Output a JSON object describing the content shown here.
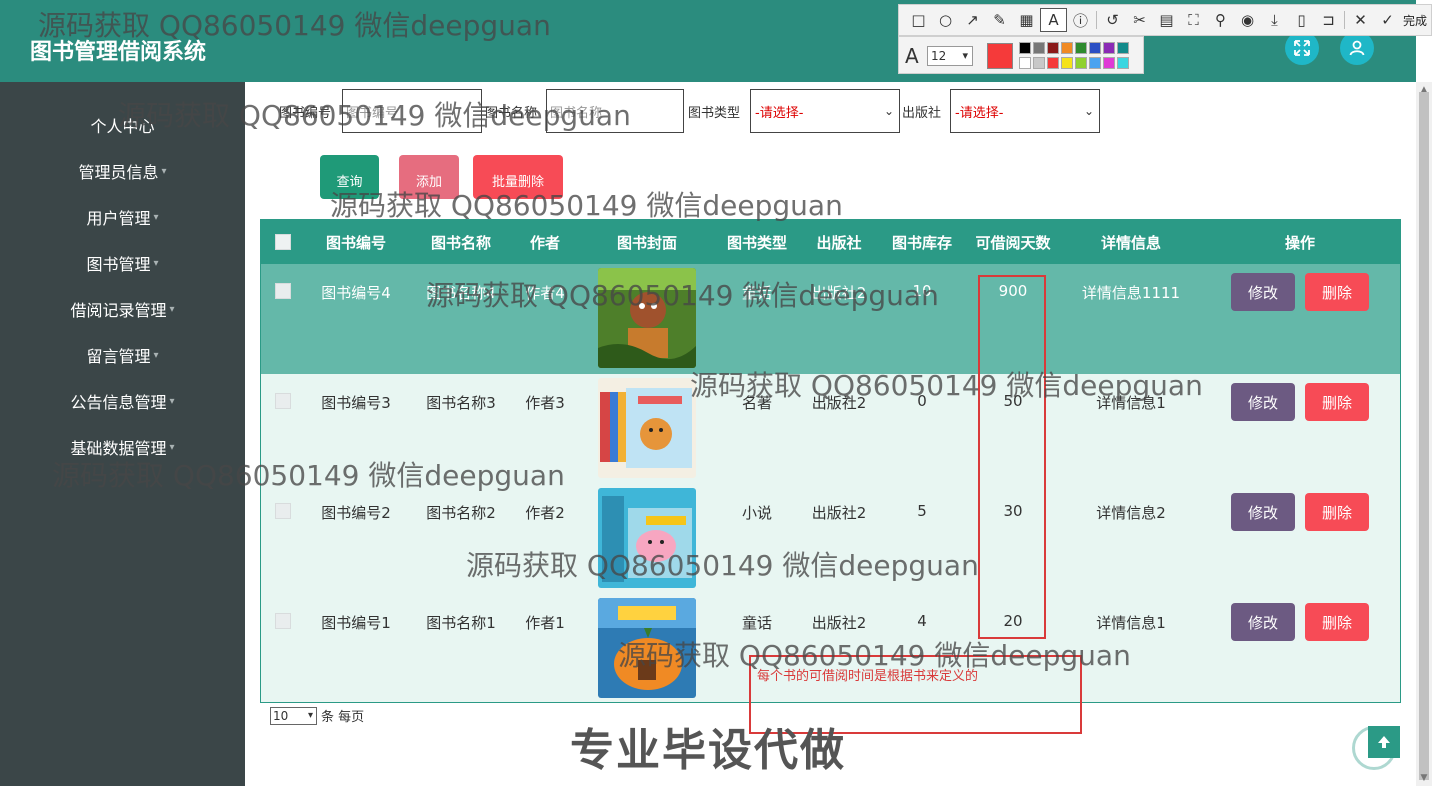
{
  "app": {
    "title": "图书管理借阅系统"
  },
  "watermark": {
    "text": "源码获取 QQ86050149 微信deepguan",
    "overlay": "专业毕设代做"
  },
  "sidebar": {
    "items": [
      {
        "label": "个人中心",
        "caret": false
      },
      {
        "label": "管理员信息",
        "caret": true
      },
      {
        "label": "用户管理",
        "caret": true
      },
      {
        "label": "图书管理",
        "caret": true
      },
      {
        "label": "借阅记录管理",
        "caret": true
      },
      {
        "label": "留言管理",
        "caret": true
      },
      {
        "label": "公告信息管理",
        "caret": true
      },
      {
        "label": "基础数据管理",
        "caret": true
      }
    ]
  },
  "filters": {
    "book_no_label": "图书编号",
    "book_no_placeholder": "图书编号",
    "book_name_label": "图书名称",
    "book_name_placeholder": "图书名称",
    "book_type_label": "图书类型",
    "book_type_value": "-请选择-",
    "publisher_label": "出版社",
    "publisher_value": "-请选择-"
  },
  "actions": {
    "search": "查询",
    "add": "添加",
    "batch_delete": "批量删除"
  },
  "table": {
    "headers": [
      "图书编号",
      "图书名称",
      "作者",
      "图书封面",
      "图书类型",
      "出版社",
      "图书库存",
      "可借阅天数",
      "详情信息",
      "操作"
    ],
    "edit_label": "修改",
    "delete_label": "删除",
    "rows": [
      {
        "no": "图书编号4",
        "name": "图书名称4",
        "author": "作者4",
        "type": "童话",
        "publisher": "出版社2",
        "stock": "10",
        "days": "900",
        "detail": "详情信息1111"
      },
      {
        "no": "图书编号3",
        "name": "图书名称3",
        "author": "作者3",
        "type": "名著",
        "publisher": "出版社2",
        "stock": "0",
        "days": "50",
        "detail": "详情信息1"
      },
      {
        "no": "图书编号2",
        "name": "图书名称2",
        "author": "作者2",
        "type": "小说",
        "publisher": "出版社2",
        "stock": "5",
        "days": "30",
        "detail": "详情信息2"
      },
      {
        "no": "图书编号1",
        "name": "图书名称1",
        "author": "作者1",
        "type": "童话",
        "publisher": "出版社2",
        "stock": "4",
        "days": "20",
        "detail": "详情信息1"
      }
    ]
  },
  "pagination": {
    "page_size": "10",
    "suffix": "条 每页"
  },
  "annotation": {
    "note": "每个书的可借阅时间是根据书来定义的"
  },
  "snap_toolbar": {
    "done_label": "完成",
    "font_size": "12"
  },
  "colors": {
    "header": "#2b8c7e",
    "sidebar": "#3b4648",
    "table_header": "#2b9a86",
    "row_highlight": "#64b8a9",
    "edit": "#6c5a82",
    "delete": "#f74b56",
    "annotation": "#d93a3a"
  }
}
